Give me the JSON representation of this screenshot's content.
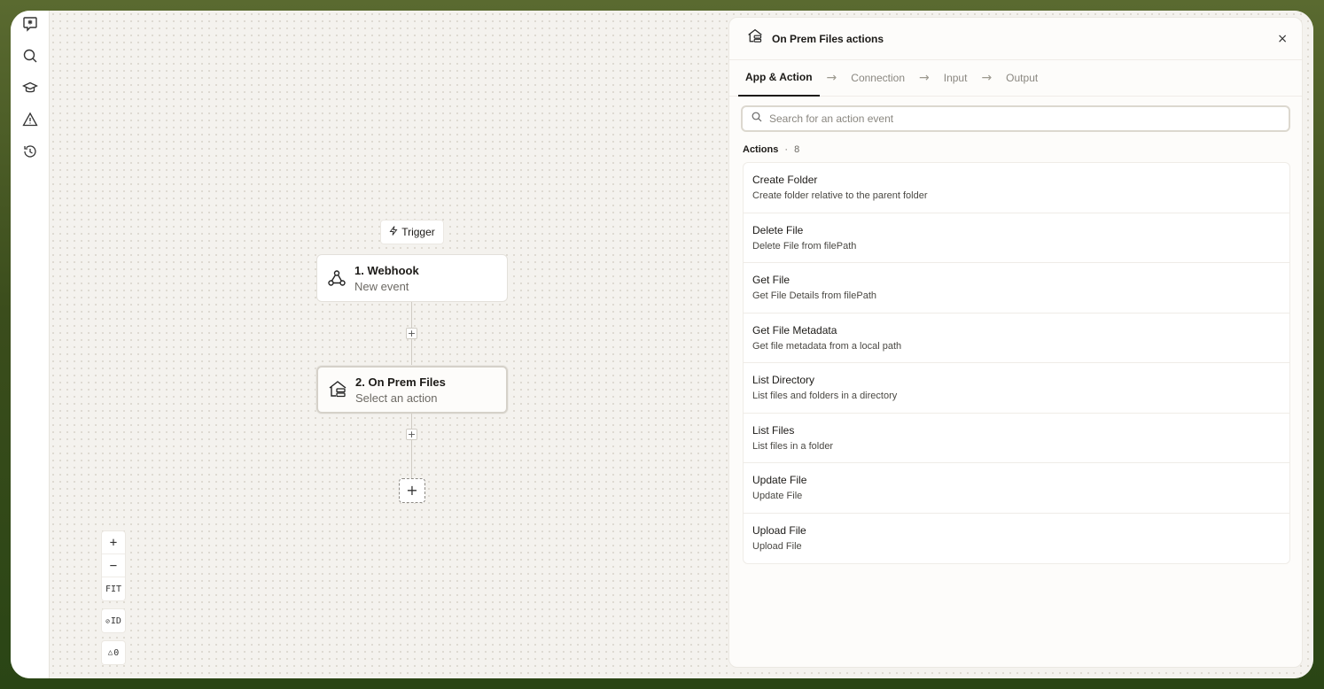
{
  "canvas": {
    "trigger_label": "Trigger",
    "nodes": [
      {
        "title": "1. Webhook",
        "subtitle": "New event"
      },
      {
        "title": "2. On Prem Files",
        "subtitle": "Select an action"
      }
    ],
    "zoom": {
      "in": "+",
      "out": "−",
      "fit": "FIT",
      "id": "ID",
      "warnings": "0"
    }
  },
  "panel": {
    "title": "On Prem Files actions",
    "close": "×",
    "tabs": [
      {
        "label": "App & Action"
      },
      {
        "label": "Connection"
      },
      {
        "label": "Input"
      },
      {
        "label": "Output"
      }
    ],
    "tab_arrow": "→",
    "search_placeholder": "Search for an action event",
    "actions_label": "Actions",
    "actions_count": "8",
    "actions": [
      {
        "title": "Create Folder",
        "desc": "Create folder relative to the parent folder"
      },
      {
        "title": "Delete File",
        "desc": "Delete File from filePath"
      },
      {
        "title": "Get File",
        "desc": "Get File Details from filePath"
      },
      {
        "title": "Get File Metadata",
        "desc": "Get file metadata from a local path"
      },
      {
        "title": "List Directory",
        "desc": "List files and folders in a directory"
      },
      {
        "title": "List Files",
        "desc": "List files in a folder"
      },
      {
        "title": "Update File",
        "desc": "Update File"
      },
      {
        "title": "Upload File",
        "desc": "Upload File"
      }
    ]
  },
  "icons": {
    "rail": [
      "logo-icon",
      "search-icon",
      "learn-icon",
      "warning-icon",
      "history-icon"
    ]
  }
}
